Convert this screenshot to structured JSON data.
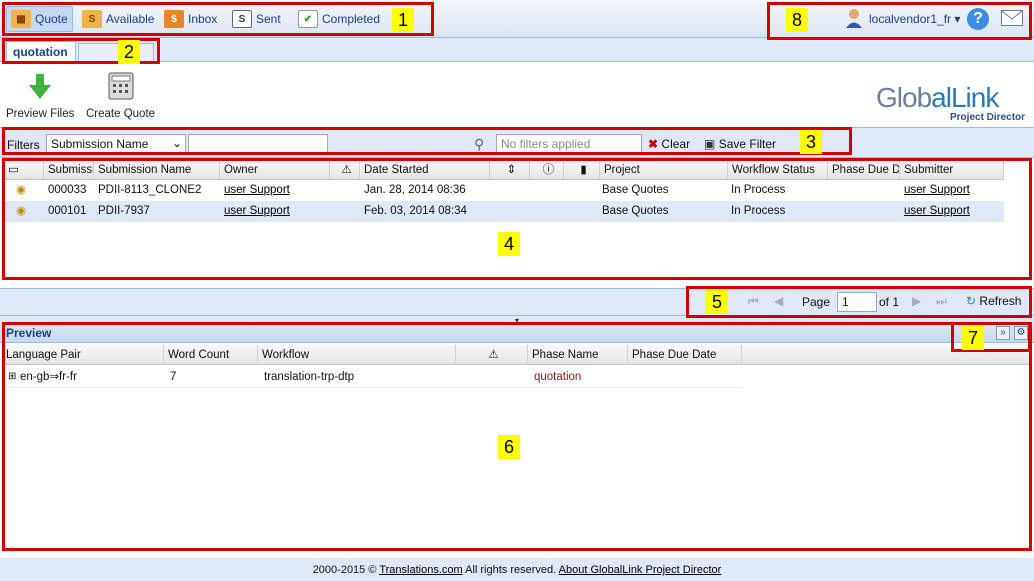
{
  "toolbar": {
    "items": [
      {
        "label": "Quote",
        "icon": "quote-icon"
      },
      {
        "label": "Available",
        "icon": "available-icon"
      },
      {
        "label": "Inbox",
        "icon": "inbox-icon"
      },
      {
        "label": "Sent",
        "icon": "sent-icon"
      },
      {
        "label": "Completed",
        "icon": "completed-icon"
      }
    ],
    "user": "localvendor1_fr",
    "help_icon": "help-icon",
    "mail_icon": "mail-icon"
  },
  "tabs": [
    {
      "label": "quotation"
    }
  ],
  "actions": [
    {
      "label": "Preview Files",
      "icon": "download-arrow-icon"
    },
    {
      "label": "Create Quote",
      "icon": "calculator-icon"
    }
  ],
  "logo": {
    "text_a": "Glob",
    "text_b": "alLink",
    "sub": "Project Director"
  },
  "filters": {
    "label": "Filters",
    "selected": "Submission Name",
    "search_placeholder": "No filters applied",
    "clear": "Clear",
    "save": "Save Filter"
  },
  "submissions": {
    "columns": [
      "Submissi",
      "Submission Name",
      "Owner",
      "Date Started",
      "Project",
      "Workflow Status",
      "Phase Due Da",
      "Submitter"
    ],
    "rows": [
      {
        "id": "000033",
        "name": "PDII-8113_CLONE2",
        "owner": "user Support",
        "date": "Jan. 28, 2014 08:36",
        "project": "Base Quotes",
        "status": "In Process",
        "submitter": "user Support"
      },
      {
        "id": "000101",
        "name": "PDII-7937",
        "owner": "user Support",
        "date": "Feb. 03, 2014 08:34",
        "project": "Base Quotes",
        "status": "In Process",
        "submitter": "user Support"
      }
    ]
  },
  "pager": {
    "page_label": "Page",
    "page_value": "1",
    "of_label": "of 1",
    "refresh": "Refresh"
  },
  "preview": {
    "title": "Preview",
    "columns": [
      "Language Pair",
      "Word Count",
      "Workflow",
      "Phase Name",
      "Phase Due Date"
    ],
    "rows": [
      {
        "pair": "en-gb⇒fr-fr",
        "words": "7",
        "workflow": "translation-trp-dtp",
        "phase": "quotation",
        "due": ""
      }
    ]
  },
  "footer": {
    "prefix": "2000-2015 ©",
    "link1": "Translations.com",
    "middle": "All rights reserved.",
    "link2": "About GlobalLink Project Director"
  },
  "annotations": [
    "1",
    "2",
    "3",
    "4",
    "5",
    "6",
    "7",
    "8"
  ],
  "colors": {
    "annotation_border": "#d40000",
    "annotation_label_bg": "#ffff00",
    "header_blue": "#15428b",
    "phase_text": "#8b1a1a"
  }
}
